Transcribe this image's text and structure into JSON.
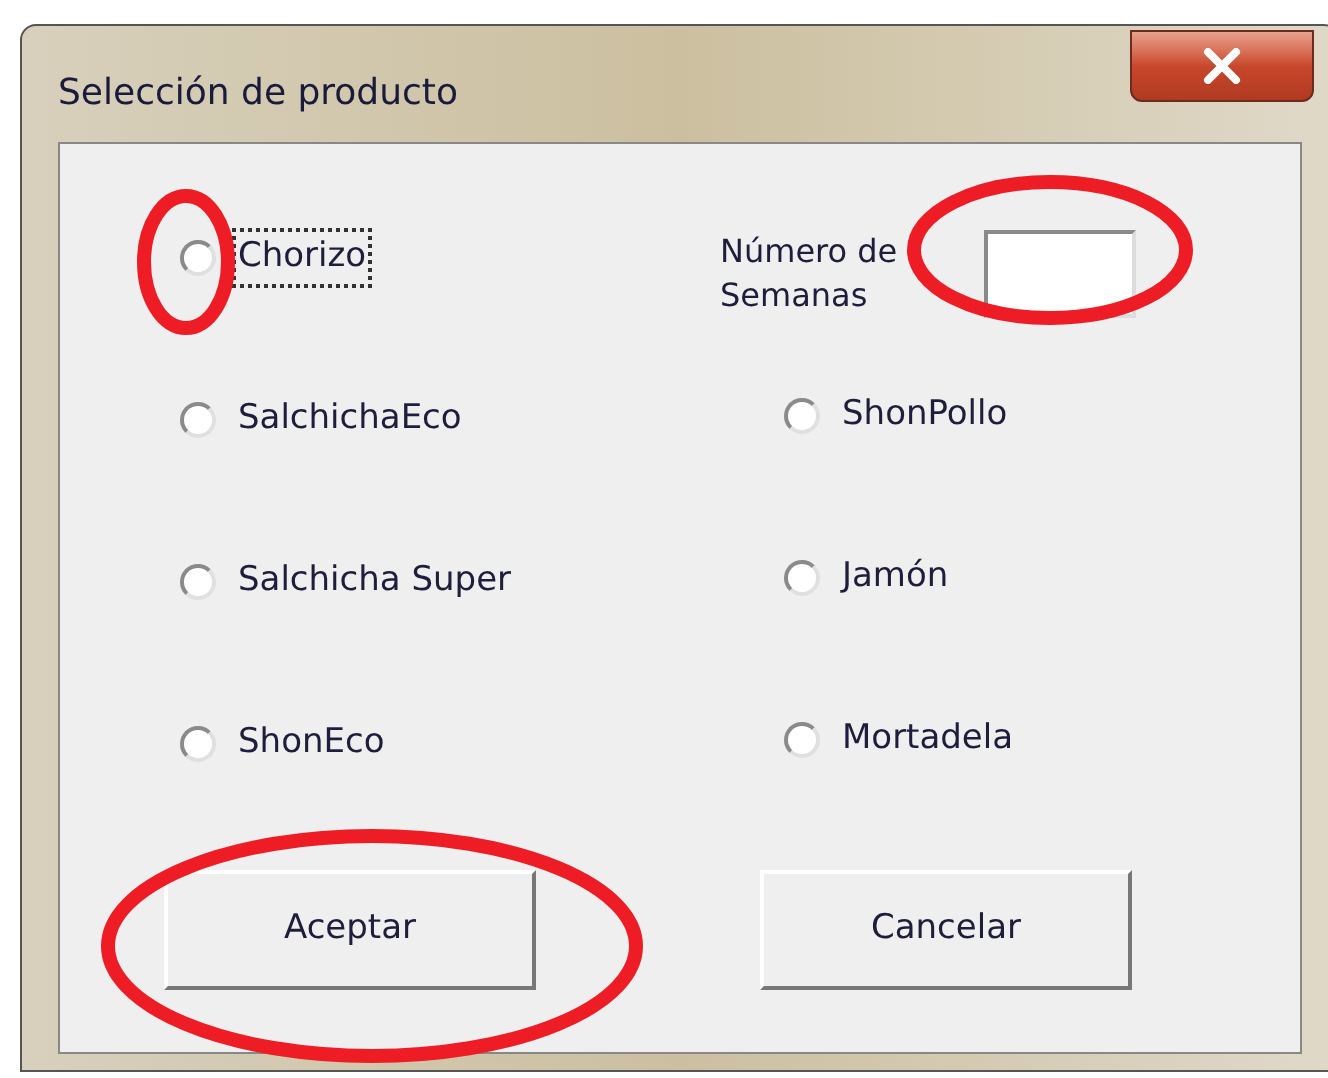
{
  "window": {
    "title": "Selección de producto"
  },
  "options": [
    {
      "label": "Chorizo",
      "selected": false,
      "focused": true
    },
    {
      "label": "SalchichaEco",
      "selected": false,
      "focused": false
    },
    {
      "label": "Salchicha Super",
      "selected": false,
      "focused": false
    },
    {
      "label": "ShonEco",
      "selected": false,
      "focused": false
    },
    {
      "label": "ShonPollo",
      "selected": false,
      "focused": false
    },
    {
      "label": "Jamón",
      "selected": false,
      "focused": false
    },
    {
      "label": "Mortadela",
      "selected": false,
      "focused": false
    }
  ],
  "weeks": {
    "label": "Número de Semanas"
  },
  "buttons": [
    "Aceptar",
    "Cancelar"
  ]
}
